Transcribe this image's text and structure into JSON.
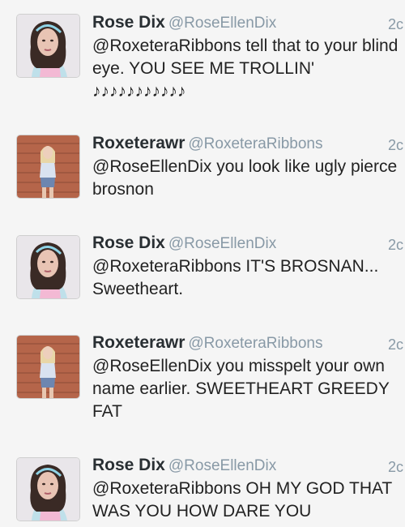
{
  "tweets": [
    {
      "name": "Rose Dix",
      "handle": "@RoseEllenDix",
      "time": "2c",
      "text": "@RoxeteraRibbons tell that to your blind eye. YOU SEE ME TROLLIN'\n♪♪♪♪♪♪♪♪♪♪♪",
      "avatar_icon": "rose-avatar"
    },
    {
      "name": "Roxeterawr",
      "handle": "@RoxeteraRibbons",
      "time": "2c",
      "text": "@RoseEllenDix you look like ugly pierce brosnon",
      "avatar_icon": "roxeterawr-avatar"
    },
    {
      "name": "Rose Dix",
      "handle": "@RoseEllenDix",
      "time": "2c",
      "text": "@RoxeteraRibbons IT'S BROSNAN... Sweetheart.",
      "avatar_icon": "rose-avatar"
    },
    {
      "name": "Roxeterawr",
      "handle": "@RoxeteraRibbons",
      "time": "2c",
      "text": "@RoseEllenDix you misspelt your own name earlier. SWEETHEART GREEDY FAT",
      "avatar_icon": "roxeterawr-avatar"
    },
    {
      "name": "Rose Dix",
      "handle": "@RoseEllenDix",
      "time": "2c",
      "text": "@RoxeteraRibbons OH MY GOD THAT WAS YOU HOW DARE YOU",
      "avatar_icon": "rose-avatar"
    }
  ],
  "colors": {
    "name": "#292f33",
    "handle": "#8899a6",
    "divider": "#dcdcdc",
    "background": "#f5f5f5"
  }
}
